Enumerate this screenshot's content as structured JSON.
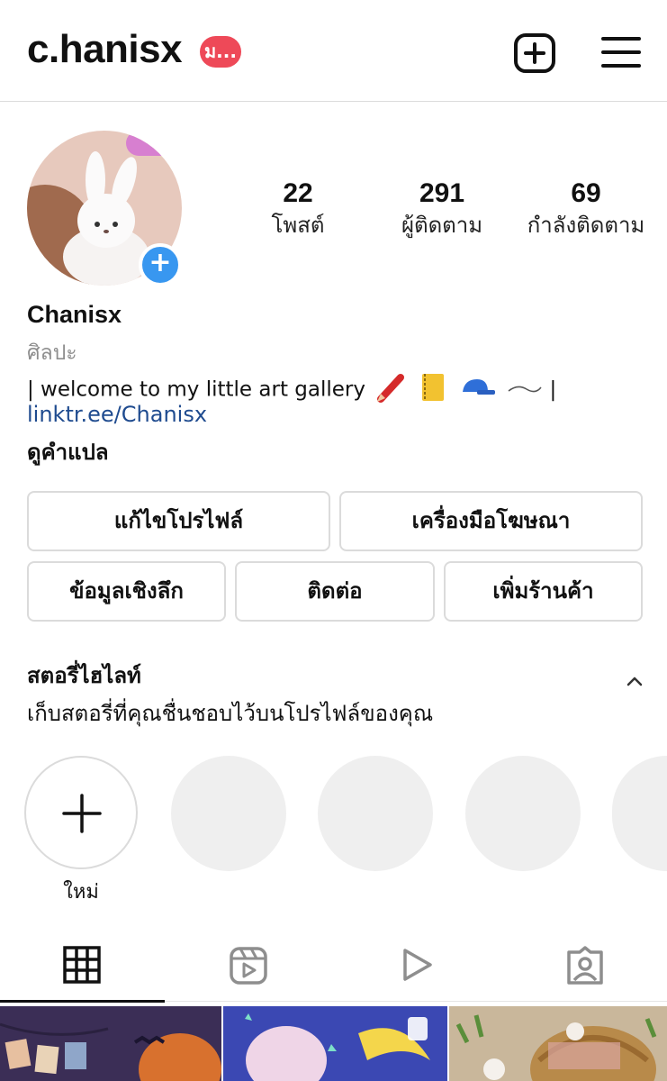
{
  "header": {
    "username": "c.hanisx",
    "notification_badge": "ม...",
    "add_post_icon": "plus-square-icon",
    "menu_icon": "hamburger-menu-icon"
  },
  "profile": {
    "avatar_add_icon": "plus-icon",
    "stats": [
      {
        "value": "22",
        "label": "โพสต์"
      },
      {
        "value": "291",
        "label": "ผู้ติดตาม"
      },
      {
        "value": "69",
        "label": "กำลังติดตาม"
      }
    ],
    "display_name": "Chanisx",
    "category": "ศิลปะ",
    "bio": "| welcome to my little art gallery",
    "bio_end": "|",
    "bio_emojis": [
      "crayon-emoji",
      "notebook-emoji",
      "cap-emoji",
      "wave-dash-emoji"
    ],
    "link": "linktr.ee/Chanisx",
    "translate_label": "ดูคำแปล"
  },
  "actions": {
    "edit_profile": "แก้ไขโปรไฟล์",
    "ad_tools": "เครื่องมือโฆษณา",
    "insights": "ข้อมูลเชิงลึก",
    "contact": "ติดต่อ",
    "add_shop": "เพิ่มร้านค้า"
  },
  "highlights": {
    "title": "สตอรี่ไฮไลท์",
    "subtitle": "เก็บสตอรี่ที่คุณชื่นชอบไว้บนโปรไฟล์ของคุณ",
    "new_label": "ใหม่",
    "collapse_icon": "chevron-up-icon"
  },
  "tabs": [
    {
      "icon": "grid-icon",
      "active": true
    },
    {
      "icon": "reels-icon",
      "active": false
    },
    {
      "icon": "play-icon",
      "active": false
    },
    {
      "icon": "tagged-icon",
      "active": false
    }
  ],
  "colors": {
    "link": "#1f4b8f",
    "badge": "#ee4958",
    "avatar_add": "#3897f0",
    "muted_text": "#8e8e8e",
    "button_border": "#dbdbdb"
  }
}
